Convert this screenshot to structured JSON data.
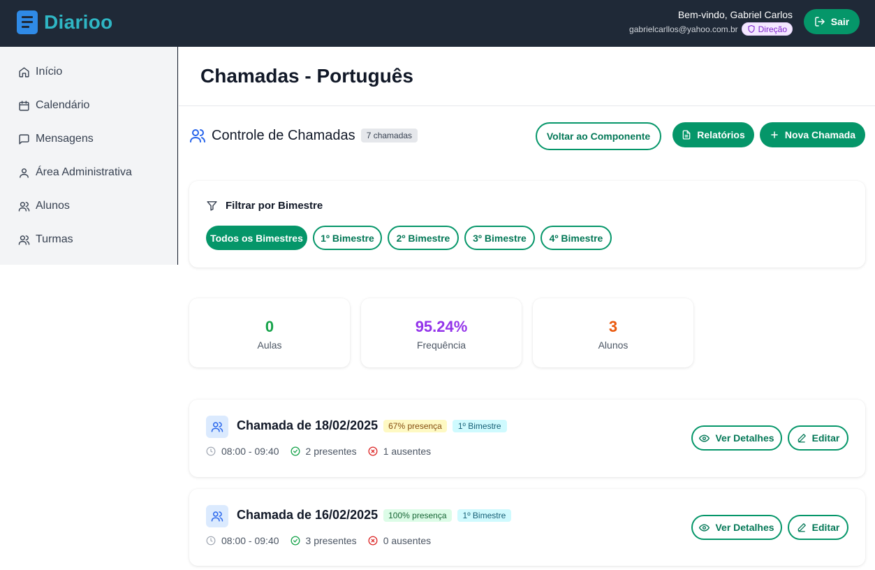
{
  "app": {
    "name": "Diarioo"
  },
  "user": {
    "welcome": "Bem-vindo, Gabriel Carlos",
    "email": "gabrielcarllos@yahoo.com.br",
    "role": "Direção",
    "logout_label": "Sair"
  },
  "sidebar": {
    "items": [
      {
        "label": "Início",
        "icon": "home-icon"
      },
      {
        "label": "Calendário",
        "icon": "calendar-icon"
      },
      {
        "label": "Mensagens",
        "icon": "message-icon"
      },
      {
        "label": "Área Administrativa",
        "icon": "user-icon"
      },
      {
        "label": "Alunos",
        "icon": "users-icon"
      },
      {
        "label": "Turmas",
        "icon": "users-icon"
      }
    ]
  },
  "page": {
    "title": "Chamadas - Português"
  },
  "section": {
    "title": "Controle de Chamadas",
    "count": "7 chamadas",
    "back_label": "Voltar ao Componente",
    "reports_label": "Relatórios",
    "new_label": "Nova Chamada"
  },
  "filter": {
    "title": "Filtrar por Bimestre",
    "options": [
      "Todos os Bimestres",
      "1º Bimestre",
      "2º Bimestre",
      "3º Bimestre",
      "4º Bimestre"
    ],
    "selected": "Todos os Bimestres"
  },
  "stats": [
    {
      "value": "0",
      "label": "Aulas",
      "color": "#16a34a"
    },
    {
      "value": "95.24%",
      "label": "Frequência",
      "color": "#9333ea"
    },
    {
      "value": "3",
      "label": "Alunos",
      "color": "#ea580c"
    }
  ],
  "calls": [
    {
      "title": "Chamada de 18/02/2025",
      "presence": "67% presença",
      "presence_bg": "#fef9c3",
      "presence_color": "#854d0e",
      "bimester": "1º Bimestre",
      "time": "08:00 - 09:40",
      "present": "2 presentes",
      "absent": "1 ausentes",
      "details_label": "Ver Detalhes",
      "edit_label": "Editar"
    },
    {
      "title": "Chamada de 16/02/2025",
      "presence": "100% presença",
      "presence_bg": "#dcfce7",
      "presence_color": "#166534",
      "bimester": "1º Bimestre",
      "time": "08:00 - 09:40",
      "present": "3 presentes",
      "absent": "0 ausentes",
      "details_label": "Ver Detalhes",
      "edit_label": "Editar"
    }
  ]
}
